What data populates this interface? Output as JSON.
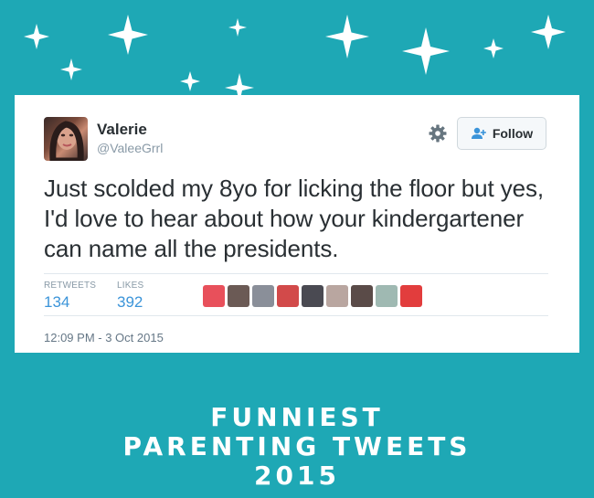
{
  "theme": {
    "background": "#1ea8b5",
    "card": "#ffffff",
    "link_blue": "#3b94d9"
  },
  "tweet": {
    "author_name": "Valerie",
    "author_handle": "@ValeeGrrl",
    "follow_label": "Follow",
    "text": "Just scolded my 8yo for licking the floor but yes, I'd love to hear about how your kindergartener can name all the presidents.",
    "retweets_label": "RETWEETS",
    "retweets_count": "134",
    "likes_label": "LIKES",
    "likes_count": "392",
    "timestamp": "12:09 PM - 3 Oct 2015",
    "liker_avatar_colors": [
      "#e8505b",
      "#6b5a55",
      "#8a8f99",
      "#d24a4a",
      "#4a4a52",
      "#b9a6a0",
      "#5a4b48",
      "#9fb9b2",
      "#e23d3d"
    ]
  },
  "caption": {
    "line1": "FUNNIEST",
    "line2": "PARENTING TWEETS",
    "line3": "2015"
  }
}
